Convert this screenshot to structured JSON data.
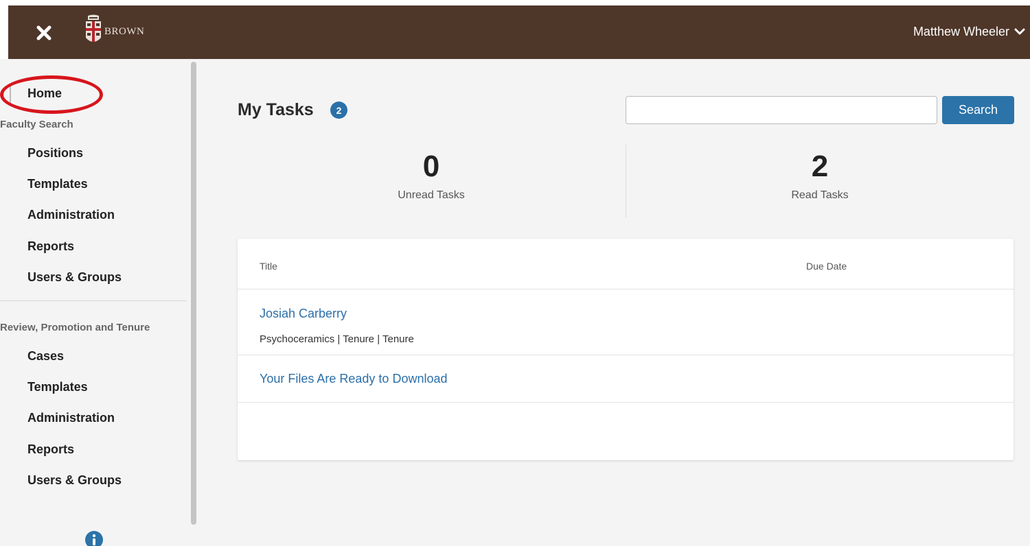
{
  "header": {
    "logo_text": "BROWN",
    "user_name": "Matthew Wheeler"
  },
  "sidebar": {
    "home": "Home",
    "sections": [
      {
        "heading": "Faculty Search",
        "items": [
          "Positions",
          "Templates",
          "Administration",
          "Reports",
          "Users & Groups"
        ]
      },
      {
        "heading": "Review, Promotion and Tenure",
        "items": [
          "Cases",
          "Templates",
          "Administration",
          "Reports",
          "Users & Groups"
        ]
      }
    ]
  },
  "main": {
    "title": "My Tasks",
    "badge_count": "2",
    "search": {
      "value": "",
      "placeholder": "",
      "button_label": "Search"
    },
    "stats": [
      {
        "value": "0",
        "label": "Unread Tasks"
      },
      {
        "value": "2",
        "label": "Read Tasks"
      }
    ],
    "table": {
      "columns": [
        "Title",
        "Due Date"
      ],
      "rows": [
        {
          "title": "Josiah Carberry",
          "meta": "Psychoceramics | Tenure | Tenure"
        },
        {
          "title": "Your Files Are Ready to Download",
          "meta": ""
        }
      ]
    }
  },
  "colors": {
    "header_bg": "#4e3629",
    "accent_blue": "#2b73a8",
    "highlight_red": "#d7151c"
  }
}
